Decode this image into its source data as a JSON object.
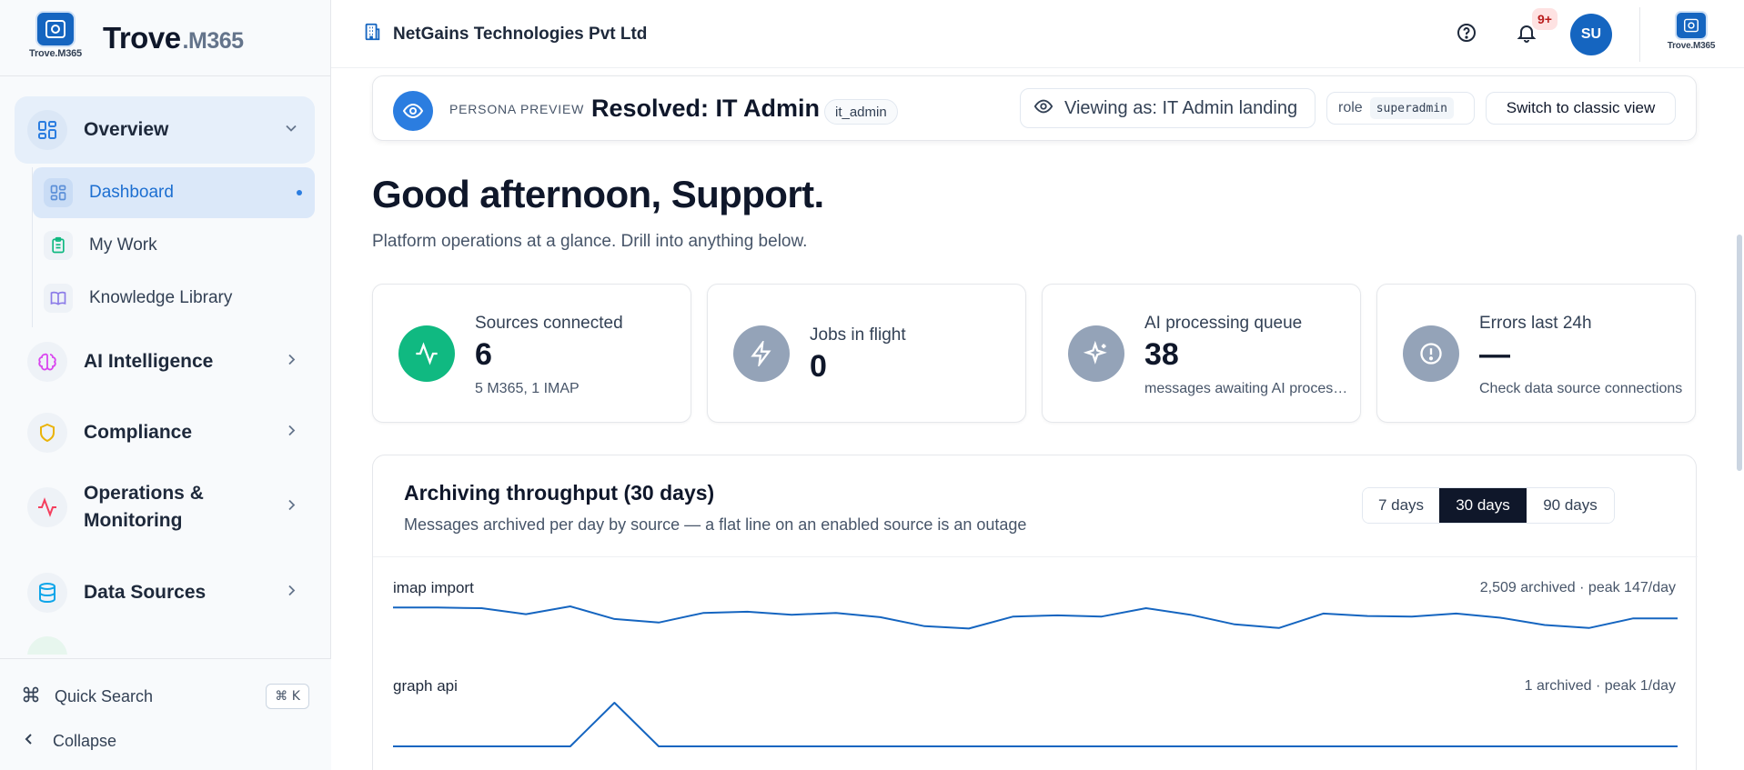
{
  "brand": {
    "logo_caption": "Trove.M365",
    "name": "Trove",
    "suffix": ".M365"
  },
  "sidebar": {
    "groups": [
      {
        "label": "Overview",
        "icon": "grid-icon",
        "expanded": true
      },
      {
        "label": "AI Intelligence",
        "icon": "brain-icon"
      },
      {
        "label": "Compliance",
        "icon": "shield-icon"
      },
      {
        "label": "Operations & Monitoring",
        "icon": "activity-icon"
      },
      {
        "label": "Data Sources",
        "icon": "database-icon"
      }
    ],
    "sub_items": [
      {
        "label": "Dashboard",
        "icon": "grid-icon",
        "active": true
      },
      {
        "label": "My Work",
        "icon": "clipboard-icon"
      },
      {
        "label": "Knowledge Library",
        "icon": "book-icon"
      }
    ],
    "quick_search": {
      "label": "Quick Search",
      "shortcut": "⌘ K"
    },
    "collapse_label": "Collapse"
  },
  "header": {
    "org_name": "NetGains Technologies Pvt Ltd",
    "notification_badge": "9+",
    "avatar_initials": "SU",
    "logo_caption": "Trove.M365"
  },
  "persona": {
    "tag": "PERSONA PREVIEW",
    "title": "Resolved: IT Admin",
    "code": "it_admin",
    "viewing_as": "Viewing as: IT Admin landing",
    "role_label": "role",
    "role_value": "superadmin",
    "switch_label": "Switch to classic view"
  },
  "greeting": {
    "title": "Good afternoon, Support.",
    "subtitle": "Platform operations at a glance. Drill into anything below."
  },
  "cards": [
    {
      "title": "Sources connected",
      "value": "6",
      "sub": "5 M365, 1 IMAP",
      "icon": "activity-icon",
      "color": "#10b981"
    },
    {
      "title": "Jobs in flight",
      "value": "0",
      "sub": "",
      "icon": "zap-icon",
      "color": "#94a3b8"
    },
    {
      "title": "AI processing queue",
      "value": "38",
      "sub": "messages awaiting AI processing",
      "icon": "sparkles-icon",
      "color": "#94a3b8"
    },
    {
      "title": "Errors last 24h",
      "value": "—",
      "sub": "Check data source connections",
      "icon": "alert-circle-icon",
      "color": "#94a3b8"
    }
  ],
  "throughput": {
    "title": "Archiving throughput (30 days)",
    "subtitle": "Messages archived per day by source — a flat line on an enabled source is an outage",
    "ranges": [
      "7 days",
      "30 days",
      "90 days"
    ],
    "selected_range": "30 days",
    "line_color": "#1565c0"
  },
  "chart_data": {
    "type": "line",
    "series": [
      {
        "name": "imap import",
        "stat": "2,509 archived · peak 147/day",
        "values": [
          98,
          98,
          97,
          87,
          100,
          79,
          73,
          89,
          91,
          86,
          89,
          82,
          67,
          63,
          83,
          85,
          83,
          97,
          86,
          70,
          64,
          88,
          84,
          83,
          88,
          81,
          69,
          64,
          80,
          80
        ]
      },
      {
        "name": "graph api",
        "stat": "1 archived · peak 1/day",
        "values": [
          0,
          0,
          0,
          0,
          0,
          1,
          0,
          0,
          0,
          0,
          0,
          0,
          0,
          0,
          0,
          0,
          0,
          0,
          0,
          0,
          0,
          0,
          0,
          0,
          0,
          0,
          0,
          0,
          0,
          0
        ]
      }
    ]
  }
}
